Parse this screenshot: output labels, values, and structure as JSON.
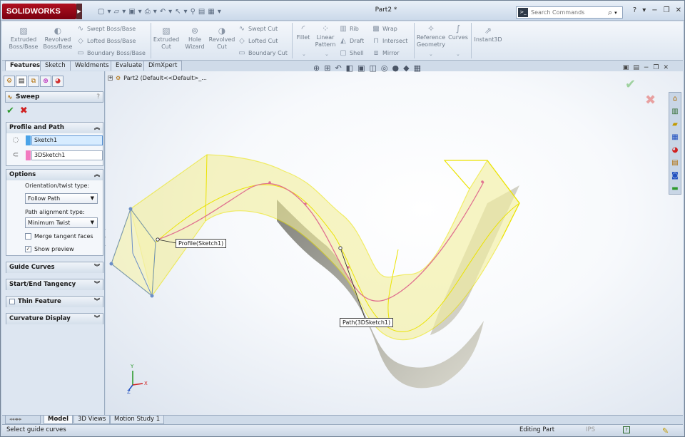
{
  "app": {
    "logo": "SOLIDWORKS",
    "document_title": "Part2 *"
  },
  "search": {
    "placeholder": "Search Commands"
  },
  "ribbon": {
    "extruded_boss": "Extruded Boss/Base",
    "revolved_boss": "Revolved Boss/Base",
    "swept_boss": "Swept Boss/Base",
    "lofted_boss": "Lofted Boss/Base",
    "boundary_boss": "Boundary Boss/Base",
    "extruded_cut": "Extruded Cut",
    "hole_wizard": "Hole Wizard",
    "revolved_cut": "Revolved Cut",
    "swept_cut": "Swept Cut",
    "lofted_cut": "Lofted Cut",
    "boundary_cut": "Boundary Cut",
    "fillet": "Fillet",
    "linear_pattern": "Linear Pattern",
    "rib": "Rib",
    "draft": "Draft",
    "shell": "Shell",
    "wrap": "Wrap",
    "intersect": "Intersect",
    "mirror": "Mirror",
    "reference_geometry": "Reference Geometry",
    "curves": "Curves",
    "instant3d": "Instant3D"
  },
  "command_tabs": [
    "Features",
    "Sketch",
    "Weldments",
    "Evaluate",
    "DimXpert"
  ],
  "property_manager": {
    "title": "Sweep",
    "help": "?",
    "profile_and_path": {
      "header": "Profile and Path",
      "profile": "Sketch1",
      "path": "3DSketch1"
    },
    "options": {
      "header": "Options",
      "orientation_label": "Orientation/twist type:",
      "orientation_value": "Follow Path",
      "alignment_label": "Path alignment type:",
      "alignment_value": "Minimum Twist",
      "merge_tangent": "Merge tangent faces",
      "merge_tangent_checked": false,
      "show_preview": "Show preview",
      "show_preview_checked": true
    },
    "collapsed_groups": [
      "Guide Curves",
      "Start/End Tangency",
      "Thin Feature",
      "Curvature Display"
    ]
  },
  "tree": {
    "item": "Part2  (Default<<Default>_..."
  },
  "callouts": {
    "profile": "Profile(Sketch1)",
    "path": "Path(3DSketch1)"
  },
  "triad": {
    "x": "X",
    "y": "Y",
    "z": "Z"
  },
  "bottom_tabs": [
    "Model",
    "3D Views",
    "Motion Study 1"
  ],
  "status": {
    "message": "Select guide curves",
    "mode": "Editing Part",
    "units": "IPS",
    "help": "?"
  },
  "colors": {
    "profile_swatch": "#4aa3e8",
    "path_swatch": "#f27ac0",
    "sweep_fill": "#f4f0a0",
    "sweep_edge": "#e8e400",
    "path_line": "#e07090",
    "ok_green": "#2e9a2e",
    "cancel_red": "#d02020"
  }
}
